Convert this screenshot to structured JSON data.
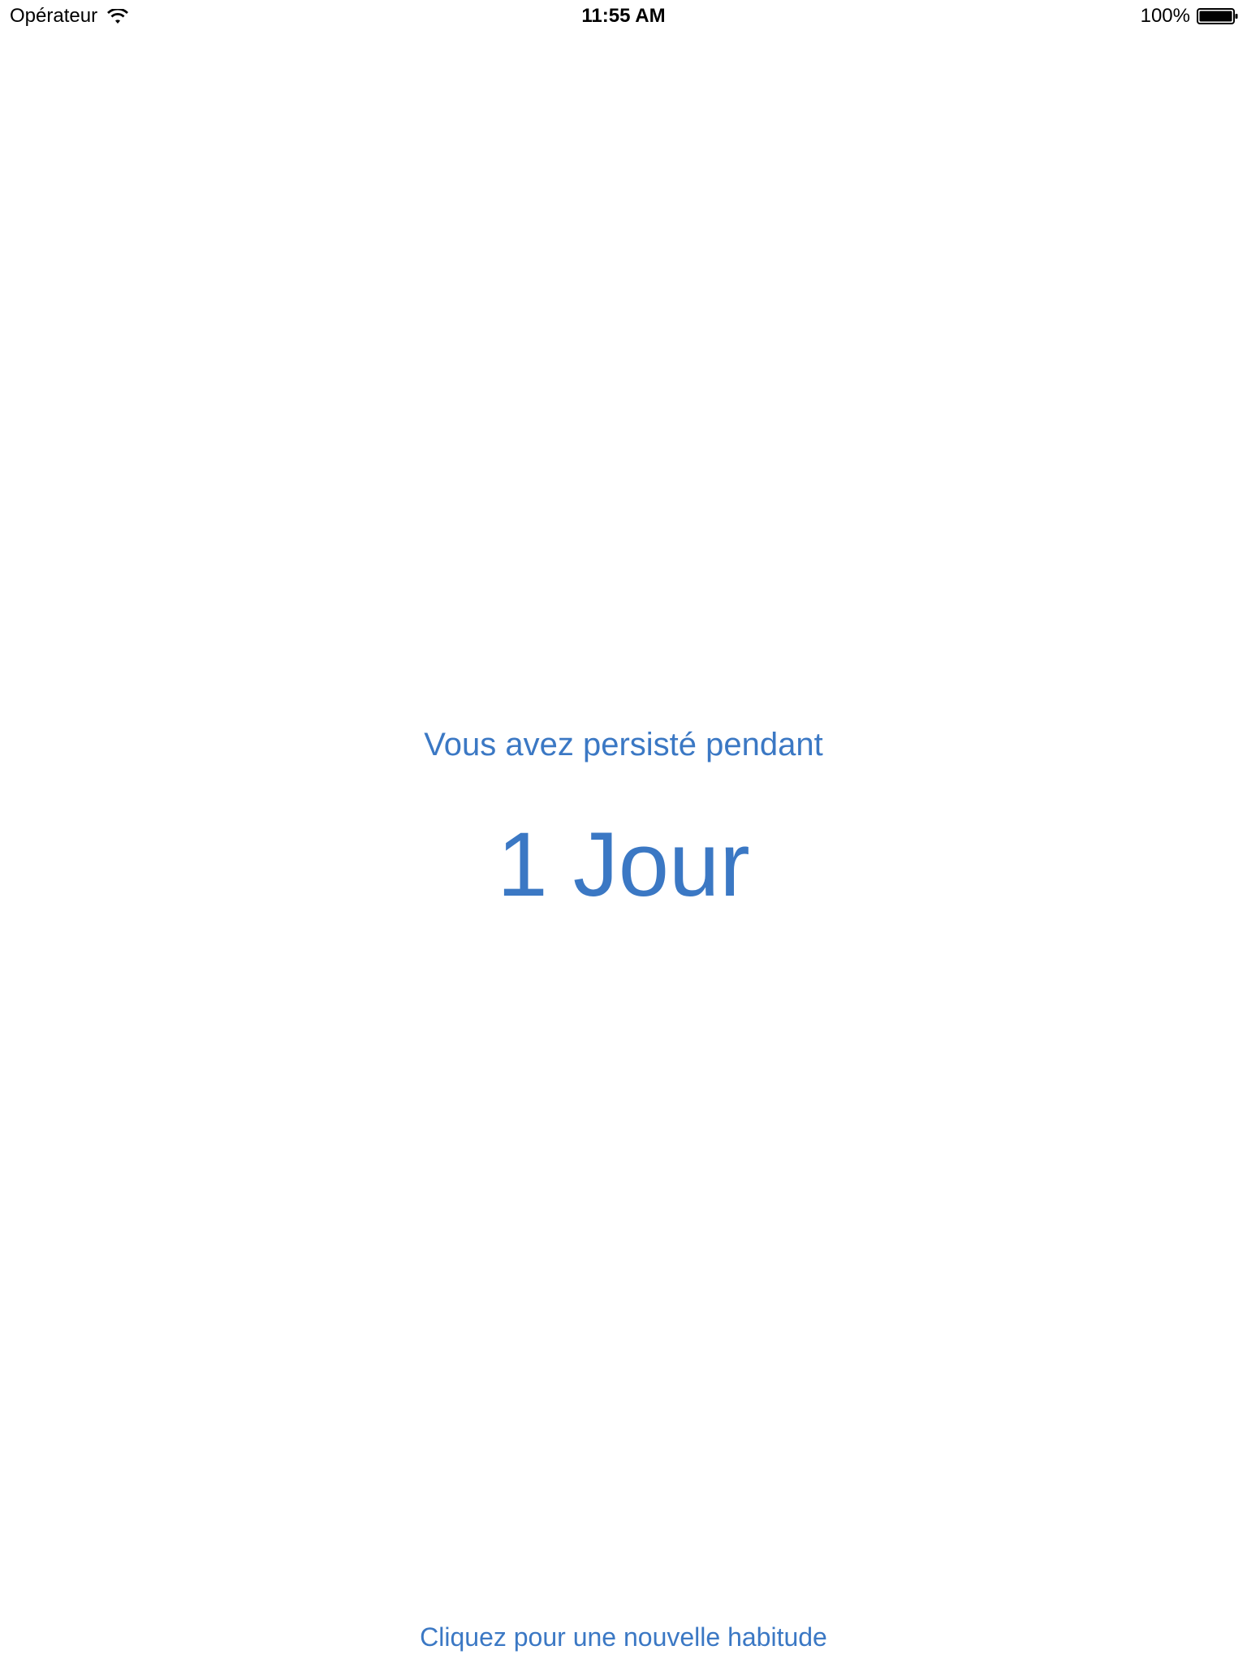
{
  "status_bar": {
    "carrier": "Opérateur",
    "wifi_icon": "wifi-icon",
    "time": "11:55 AM",
    "battery_percent": "100%",
    "battery_icon": "battery-icon",
    "battery_level": 1.0
  },
  "content": {
    "subtitle": "Vous avez persisté pendant",
    "counter": "1 Jour",
    "new_habit_label": "Cliquez pour une nouvelle habitude"
  },
  "colors": {
    "accent": "#3b78c4",
    "background": "#ffffff"
  }
}
